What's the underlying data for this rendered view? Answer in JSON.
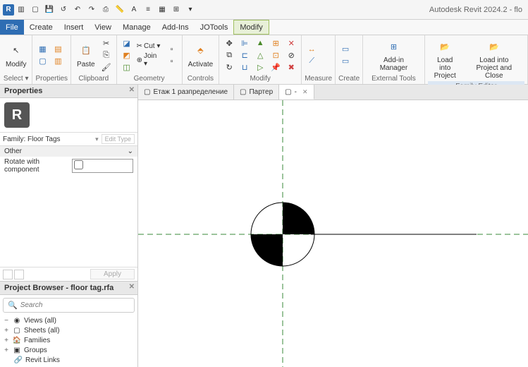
{
  "app_title": "Autodesk Revit 2024.2 - flo",
  "menu": {
    "file": "File",
    "items": [
      "Create",
      "Insert",
      "View",
      "Manage",
      "Add-Ins",
      "JOTools",
      "Modify"
    ],
    "active": "Modify"
  },
  "ribbon": {
    "select": {
      "modify": "Modify",
      "label": "Select ▾"
    },
    "properties": {
      "label": "Properties"
    },
    "clipboard": {
      "paste": "Paste",
      "label": "Clipboard"
    },
    "geometry": {
      "cut": "Cut ▾",
      "join": "Join ▾",
      "label": "Geometry"
    },
    "activate": {
      "btn": "Activate",
      "label": "Controls"
    },
    "modify": {
      "label": "Modify"
    },
    "measure": {
      "label": "Measure"
    },
    "create": {
      "label": "Create"
    },
    "addin": {
      "btn": "Add-in Manager",
      "label": "External Tools"
    },
    "load1": {
      "l1": "Load into",
      "l2": "Project"
    },
    "load2": {
      "l1": "Load into",
      "l2": "Project and Close"
    },
    "family_editor": "Family Editor"
  },
  "properties_panel": {
    "title": "Properties",
    "family_name": "Family: Floor Tags",
    "edit_type": "Edit Type",
    "section": "Other",
    "prop_rotate": "Rotate with component",
    "apply": "Apply"
  },
  "browser_panel": {
    "title": "Project Browser - floor tag.rfa",
    "search_placeholder": "Search",
    "views_all": "Views (all)",
    "sheets_all": "Sheets (all)",
    "families": "Families",
    "groups": "Groups",
    "revit_links": "Revit Links"
  },
  "tabs": {
    "t1": "Етаж 1 разпределение",
    "t2": "Партер",
    "t3": "-"
  }
}
